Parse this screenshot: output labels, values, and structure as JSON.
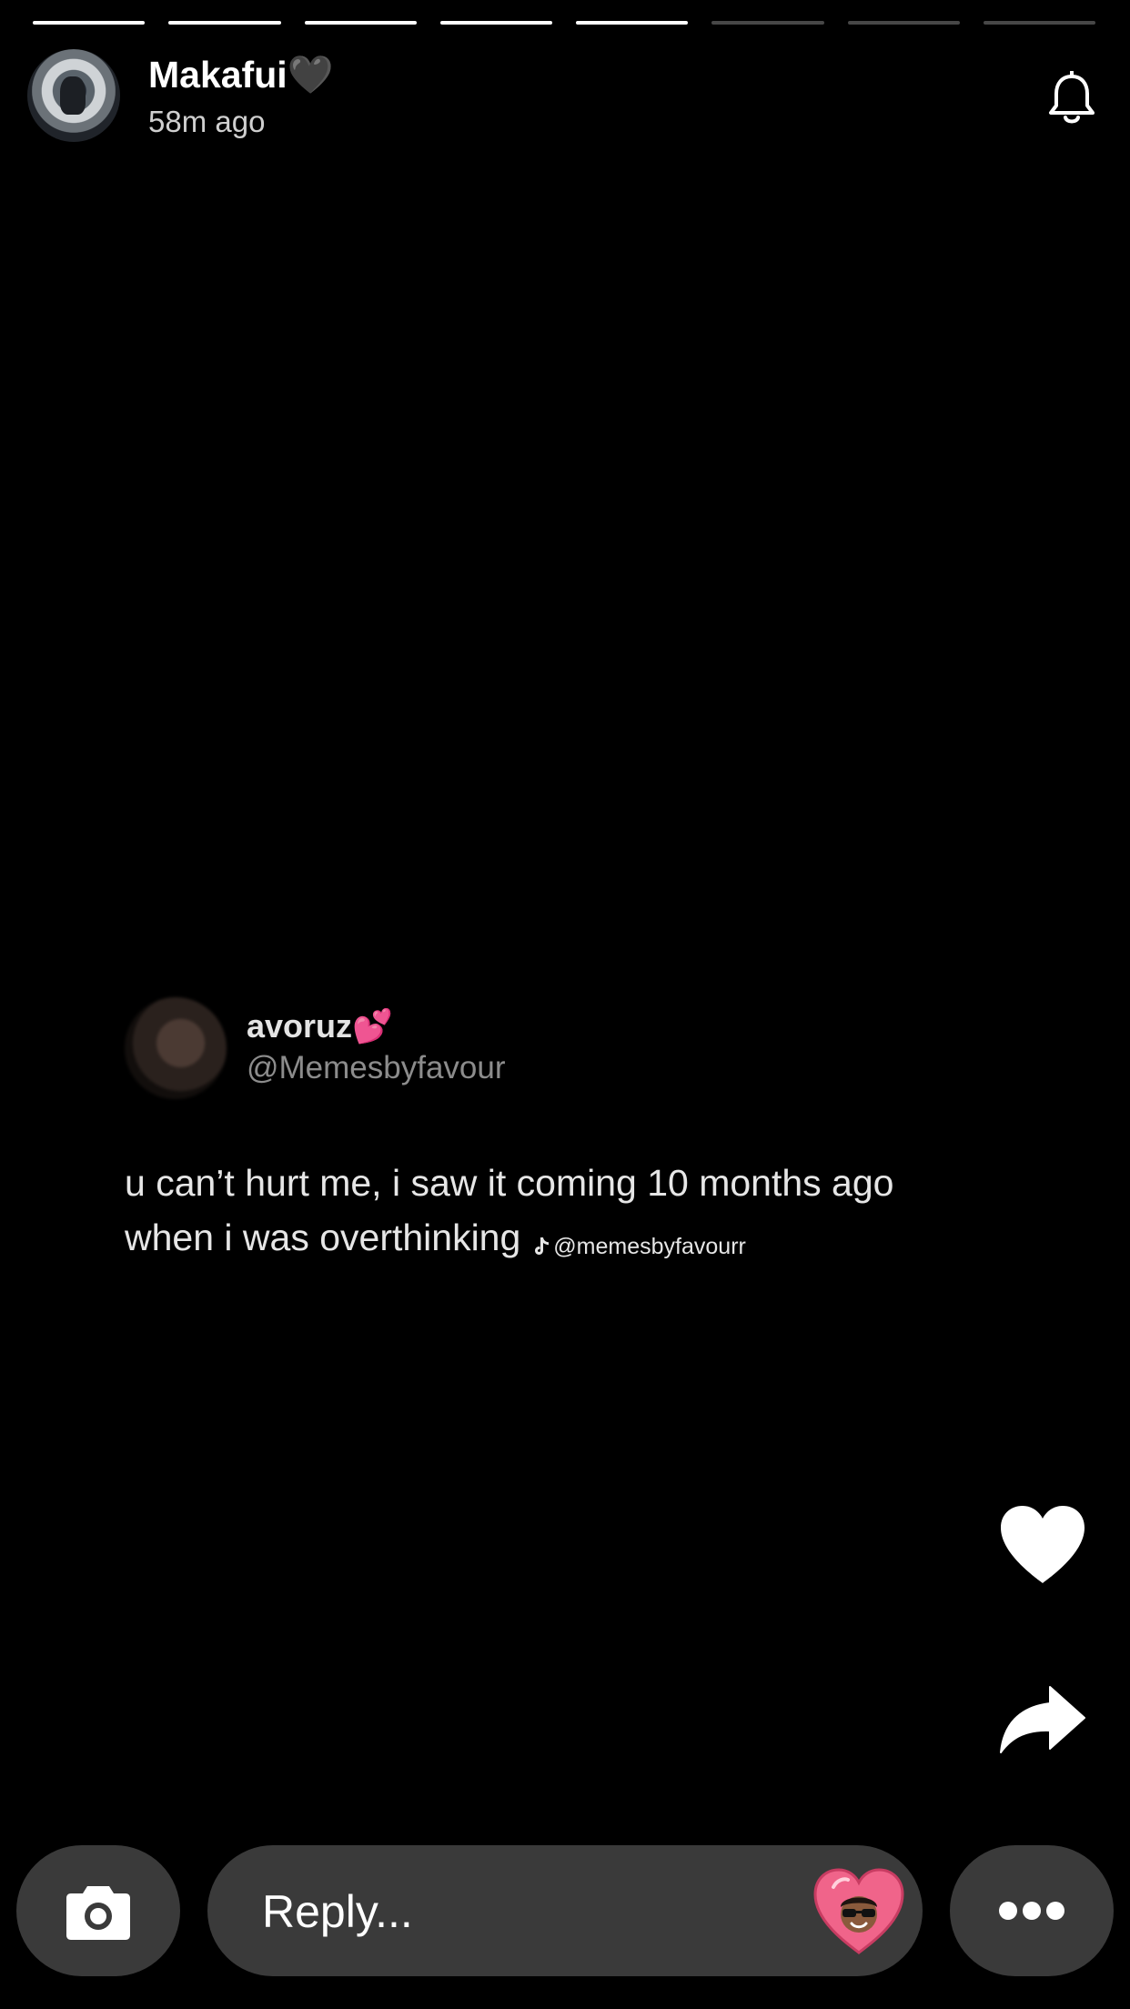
{
  "story": {
    "segments_total": 8,
    "segments_viewed": 5,
    "progress": [
      1,
      1,
      1,
      1,
      1,
      0,
      0,
      0
    ]
  },
  "header": {
    "username": "Makafui🖤",
    "timestamp": "58m ago",
    "icons": {
      "avatar": "profile-photo",
      "notify": "bell-icon"
    }
  },
  "post": {
    "display_name": "avoruz💕",
    "handle": "@Memesbyfavour",
    "text_line1": "u can’t hurt me, i saw it coming 10 months ago",
    "text_line2": "when i was overthinking",
    "watermark": "@memesbyfavourr",
    "watermark_icon": "tiktok-icon"
  },
  "actions": {
    "like_icon": "heart-icon",
    "share_icon": "share-arrow-icon"
  },
  "bottom_bar": {
    "camera_icon": "camera-icon",
    "reply_placeholder": "Reply...",
    "reaction_icon": "bitmoji-heart-icon",
    "more_icon": "more-dots-icon"
  },
  "colors": {
    "background": "#000000",
    "pill": "#3a3a3a",
    "heart_pink": "#f0648a"
  }
}
